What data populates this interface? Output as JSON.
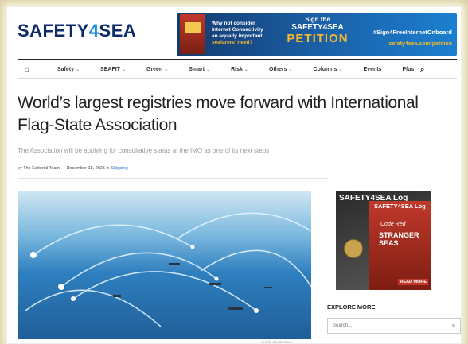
{
  "header": {
    "logo_main": "SAFETY",
    "logo_four": "4",
    "logo_end": "SEA"
  },
  "ad": {
    "line1": "Why not consider",
    "line2": "Internet Connectivity",
    "line3": "an equally important",
    "line4": "seafarers' need?",
    "sign": "Sign the",
    "brand": "SAFETY4SEA",
    "petition": "PETITION",
    "hashtag": "#Sign4FreeInternetOnboard",
    "url": "safety4sea.com/petition"
  },
  "nav": {
    "items": [
      {
        "label": "Safety",
        "dropdown": true
      },
      {
        "label": "SEAFIT",
        "dropdown": true
      },
      {
        "label": "Green",
        "dropdown": true
      },
      {
        "label": "Smart",
        "dropdown": true
      },
      {
        "label": "Risk",
        "dropdown": true
      },
      {
        "label": "Others",
        "dropdown": true
      },
      {
        "label": "Columns",
        "dropdown": true
      },
      {
        "label": "Events",
        "dropdown": false
      },
      {
        "label": "Plus",
        "dropdown": false
      }
    ],
    "chevron": "⌄"
  },
  "article": {
    "title": "World’s largest registries move forward with International Flag-State Association",
    "subtitle": "The Association will be applying for consultative status at the IMO as one of its next steps",
    "by": "by",
    "author": "The Editorial Team",
    "dash": "—",
    "date": "December 18, 2025",
    "in": "in",
    "category": "Shipping",
    "credit": "Credit: Shutterstock"
  },
  "sidebar": {
    "mag_title": "SAFETY4SEA Log",
    "cover_title": "SAFETY4SEA Log",
    "cover_red": "Code Red",
    "cover_headline": "STRANGER SEAS",
    "read_more": "READ MORE",
    "explore_title": "EXPLORE MORE",
    "search_placeholder": "Search..."
  }
}
